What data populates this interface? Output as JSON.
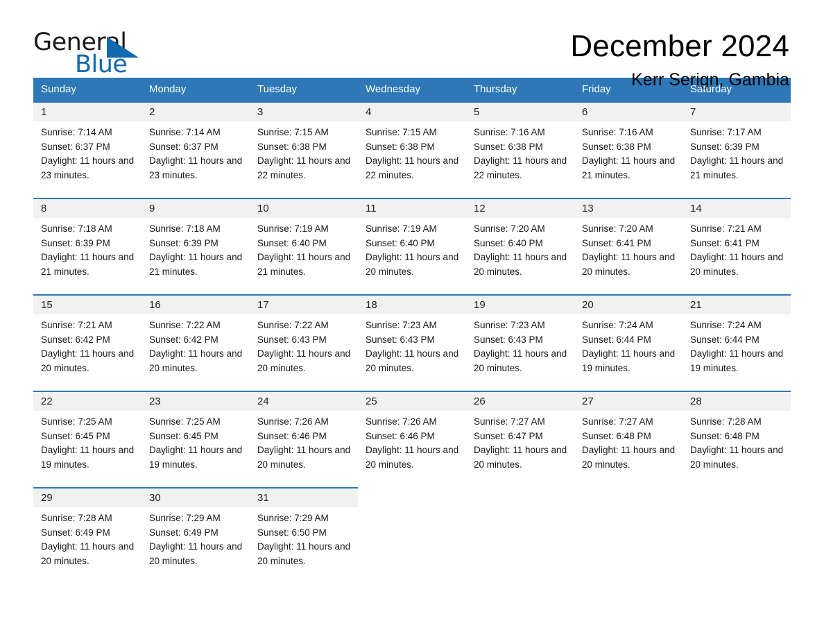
{
  "brand": {
    "name_part1": "General",
    "name_part2": "Blue",
    "flag_icon": "triangle-flag-icon"
  },
  "header": {
    "month_title": "December 2024",
    "location": "Kerr Serign, Gambia"
  },
  "colors": {
    "header_blue": "#2e78b8",
    "brand_blue": "#1269b0",
    "daynum_bg": "#f1f1f1",
    "cell_bg": "#ffffff"
  },
  "calendar": {
    "weekdays": [
      "Sunday",
      "Monday",
      "Tuesday",
      "Wednesday",
      "Thursday",
      "Friday",
      "Saturday"
    ],
    "weeks": [
      [
        {
          "day": "1",
          "sunrise": "Sunrise: 7:14 AM",
          "sunset": "Sunset: 6:37 PM",
          "daylight": "Daylight: 11 hours and 23 minutes."
        },
        {
          "day": "2",
          "sunrise": "Sunrise: 7:14 AM",
          "sunset": "Sunset: 6:37 PM",
          "daylight": "Daylight: 11 hours and 23 minutes."
        },
        {
          "day": "3",
          "sunrise": "Sunrise: 7:15 AM",
          "sunset": "Sunset: 6:38 PM",
          "daylight": "Daylight: 11 hours and 22 minutes."
        },
        {
          "day": "4",
          "sunrise": "Sunrise: 7:15 AM",
          "sunset": "Sunset: 6:38 PM",
          "daylight": "Daylight: 11 hours and 22 minutes."
        },
        {
          "day": "5",
          "sunrise": "Sunrise: 7:16 AM",
          "sunset": "Sunset: 6:38 PM",
          "daylight": "Daylight: 11 hours and 22 minutes."
        },
        {
          "day": "6",
          "sunrise": "Sunrise: 7:16 AM",
          "sunset": "Sunset: 6:38 PM",
          "daylight": "Daylight: 11 hours and 21 minutes."
        },
        {
          "day": "7",
          "sunrise": "Sunrise: 7:17 AM",
          "sunset": "Sunset: 6:39 PM",
          "daylight": "Daylight: 11 hours and 21 minutes."
        }
      ],
      [
        {
          "day": "8",
          "sunrise": "Sunrise: 7:18 AM",
          "sunset": "Sunset: 6:39 PM",
          "daylight": "Daylight: 11 hours and 21 minutes."
        },
        {
          "day": "9",
          "sunrise": "Sunrise: 7:18 AM",
          "sunset": "Sunset: 6:39 PM",
          "daylight": "Daylight: 11 hours and 21 minutes."
        },
        {
          "day": "10",
          "sunrise": "Sunrise: 7:19 AM",
          "sunset": "Sunset: 6:40 PM",
          "daylight": "Daylight: 11 hours and 21 minutes."
        },
        {
          "day": "11",
          "sunrise": "Sunrise: 7:19 AM",
          "sunset": "Sunset: 6:40 PM",
          "daylight": "Daylight: 11 hours and 20 minutes."
        },
        {
          "day": "12",
          "sunrise": "Sunrise: 7:20 AM",
          "sunset": "Sunset: 6:40 PM",
          "daylight": "Daylight: 11 hours and 20 minutes."
        },
        {
          "day": "13",
          "sunrise": "Sunrise: 7:20 AM",
          "sunset": "Sunset: 6:41 PM",
          "daylight": "Daylight: 11 hours and 20 minutes."
        },
        {
          "day": "14",
          "sunrise": "Sunrise: 7:21 AM",
          "sunset": "Sunset: 6:41 PM",
          "daylight": "Daylight: 11 hours and 20 minutes."
        }
      ],
      [
        {
          "day": "15",
          "sunrise": "Sunrise: 7:21 AM",
          "sunset": "Sunset: 6:42 PM",
          "daylight": "Daylight: 11 hours and 20 minutes."
        },
        {
          "day": "16",
          "sunrise": "Sunrise: 7:22 AM",
          "sunset": "Sunset: 6:42 PM",
          "daylight": "Daylight: 11 hours and 20 minutes."
        },
        {
          "day": "17",
          "sunrise": "Sunrise: 7:22 AM",
          "sunset": "Sunset: 6:43 PM",
          "daylight": "Daylight: 11 hours and 20 minutes."
        },
        {
          "day": "18",
          "sunrise": "Sunrise: 7:23 AM",
          "sunset": "Sunset: 6:43 PM",
          "daylight": "Daylight: 11 hours and 20 minutes."
        },
        {
          "day": "19",
          "sunrise": "Sunrise: 7:23 AM",
          "sunset": "Sunset: 6:43 PM",
          "daylight": "Daylight: 11 hours and 20 minutes."
        },
        {
          "day": "20",
          "sunrise": "Sunrise: 7:24 AM",
          "sunset": "Sunset: 6:44 PM",
          "daylight": "Daylight: 11 hours and 19 minutes."
        },
        {
          "day": "21",
          "sunrise": "Sunrise: 7:24 AM",
          "sunset": "Sunset: 6:44 PM",
          "daylight": "Daylight: 11 hours and 19 minutes."
        }
      ],
      [
        {
          "day": "22",
          "sunrise": "Sunrise: 7:25 AM",
          "sunset": "Sunset: 6:45 PM",
          "daylight": "Daylight: 11 hours and 19 minutes."
        },
        {
          "day": "23",
          "sunrise": "Sunrise: 7:25 AM",
          "sunset": "Sunset: 6:45 PM",
          "daylight": "Daylight: 11 hours and 19 minutes."
        },
        {
          "day": "24",
          "sunrise": "Sunrise: 7:26 AM",
          "sunset": "Sunset: 6:46 PM",
          "daylight": "Daylight: 11 hours and 20 minutes."
        },
        {
          "day": "25",
          "sunrise": "Sunrise: 7:26 AM",
          "sunset": "Sunset: 6:46 PM",
          "daylight": "Daylight: 11 hours and 20 minutes."
        },
        {
          "day": "26",
          "sunrise": "Sunrise: 7:27 AM",
          "sunset": "Sunset: 6:47 PM",
          "daylight": "Daylight: 11 hours and 20 minutes."
        },
        {
          "day": "27",
          "sunrise": "Sunrise: 7:27 AM",
          "sunset": "Sunset: 6:48 PM",
          "daylight": "Daylight: 11 hours and 20 minutes."
        },
        {
          "day": "28",
          "sunrise": "Sunrise: 7:28 AM",
          "sunset": "Sunset: 6:48 PM",
          "daylight": "Daylight: 11 hours and 20 minutes."
        }
      ],
      [
        {
          "day": "29",
          "sunrise": "Sunrise: 7:28 AM",
          "sunset": "Sunset: 6:49 PM",
          "daylight": "Daylight: 11 hours and 20 minutes."
        },
        {
          "day": "30",
          "sunrise": "Sunrise: 7:29 AM",
          "sunset": "Sunset: 6:49 PM",
          "daylight": "Daylight: 11 hours and 20 minutes."
        },
        {
          "day": "31",
          "sunrise": "Sunrise: 7:29 AM",
          "sunset": "Sunset: 6:50 PM",
          "daylight": "Daylight: 11 hours and 20 minutes."
        },
        {
          "day": "",
          "sunrise": "",
          "sunset": "",
          "daylight": ""
        },
        {
          "day": "",
          "sunrise": "",
          "sunset": "",
          "daylight": ""
        },
        {
          "day": "",
          "sunrise": "",
          "sunset": "",
          "daylight": ""
        },
        {
          "day": "",
          "sunrise": "",
          "sunset": "",
          "daylight": ""
        }
      ]
    ]
  }
}
